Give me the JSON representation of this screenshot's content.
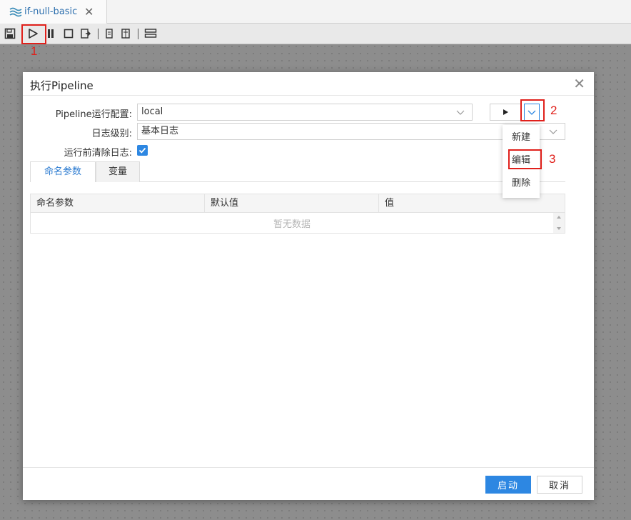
{
  "tab": {
    "title": "if-null-basic",
    "close_glyph": "✕"
  },
  "toolbar": {
    "icons": [
      "save-icon",
      "run-icon",
      "pause-icon",
      "stop-icon",
      "preview-icon",
      "debug-icon",
      "debug-steps-icon",
      "layout-icon"
    ]
  },
  "annotations": {
    "step1": "1",
    "step2": "2",
    "step3": "3"
  },
  "dialog": {
    "title": "执行Pipeline",
    "close_glyph": "✕",
    "config_label": "Pipeline运行配置:",
    "config_value": "local",
    "log_level_label": "日志级别:",
    "log_level_value": "基本日志",
    "clear_log_label": "运行前清除日志:",
    "clear_log_checked": true,
    "tabs": [
      {
        "label": "命名参数",
        "active": true
      },
      {
        "label": "变量",
        "active": false
      }
    ],
    "table": {
      "columns": [
        "命名参数",
        "默认值",
        "值"
      ],
      "empty_text": "暂无数据"
    },
    "menu": [
      "新建",
      "编辑",
      "删除"
    ],
    "start_button": "启动",
    "cancel_button": "取消"
  },
  "colors": {
    "accent": "#2d87e2",
    "annotation": "#e0201b",
    "tab_title": "#2c6fae"
  }
}
